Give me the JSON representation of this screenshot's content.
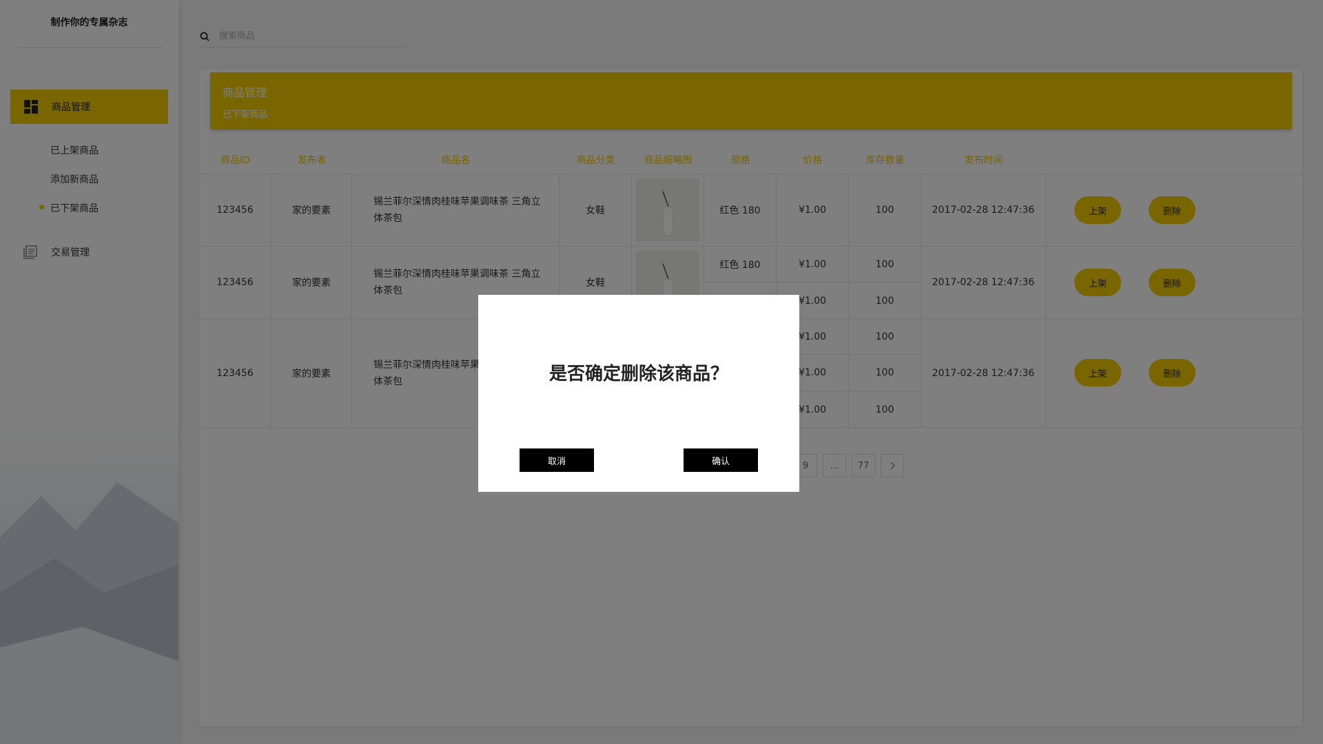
{
  "app": {
    "brand": "制作你的专属杂志"
  },
  "sidebar": {
    "active": {
      "label": "商品管理",
      "icon": "dashboard-icon"
    },
    "sub_items": [
      {
        "label": "已上架商品"
      },
      {
        "label": "添加新商品"
      },
      {
        "label": "已下架商品",
        "selected": true
      }
    ],
    "trade": {
      "label": "交易管理",
      "icon": "list-doc-icon"
    }
  },
  "search": {
    "placeholder": "搜索商品",
    "icon": "search-icon"
  },
  "banner": {
    "title": "商品管理",
    "subtitle": "已下架商品"
  },
  "table": {
    "headers": [
      "商品ID",
      "发布者",
      "商品名",
      "商品分类",
      "商品缩略图",
      "规格",
      "价格",
      "库存数量",
      "发布时间"
    ],
    "rows": [
      {
        "id": "123456",
        "publisher": "家的要素",
        "name": "锡兰菲尔深情肉桂味苹果调味茶 三角立体茶包",
        "category": "女鞋",
        "variants": [
          {
            "spec": "红色 180",
            "price": "¥1.00",
            "stock": "100"
          }
        ],
        "time": "2017-02-28 12:47:36",
        "btn_up": "上架",
        "btn_delete": "删除"
      },
      {
        "id": "123456",
        "publisher": "家的要素",
        "name": "锡兰菲尔深情肉桂味苹果调味茶 三角立体茶包",
        "category": "女鞋",
        "variants": [
          {
            "spec": "红色 180",
            "price": "¥1.00",
            "stock": "100"
          },
          {
            "spec": "",
            "price": "¥1.00",
            "stock": "100"
          }
        ],
        "time": "2017-02-28 12:47:36",
        "btn_up": "上架",
        "btn_delete": "删除"
      },
      {
        "id": "123456",
        "publisher": "家的要素",
        "name": "锡兰菲尔深情肉桂味苹果调味茶 三角立体茶包",
        "category": "",
        "variants": [
          {
            "spec": "",
            "price": "¥1.00",
            "stock": "100"
          },
          {
            "spec": "",
            "price": "¥1.00",
            "stock": "100"
          },
          {
            "spec": "",
            "price": "¥1.00",
            "stock": "100"
          }
        ],
        "time": "2017-02-28 12:47:36",
        "btn_up": "上架",
        "btn_delete": "删除"
      }
    ]
  },
  "pagination": {
    "items": [
      "9",
      "...",
      "77"
    ],
    "next_icon": "chevron-right-icon"
  },
  "modal": {
    "message": "是否确定删除该商品？",
    "cancel": "取消",
    "confirm": "确认"
  },
  "colors": {
    "accent": "#f2cd00",
    "overlay": "rgba(0,0,0,0.5)"
  }
}
